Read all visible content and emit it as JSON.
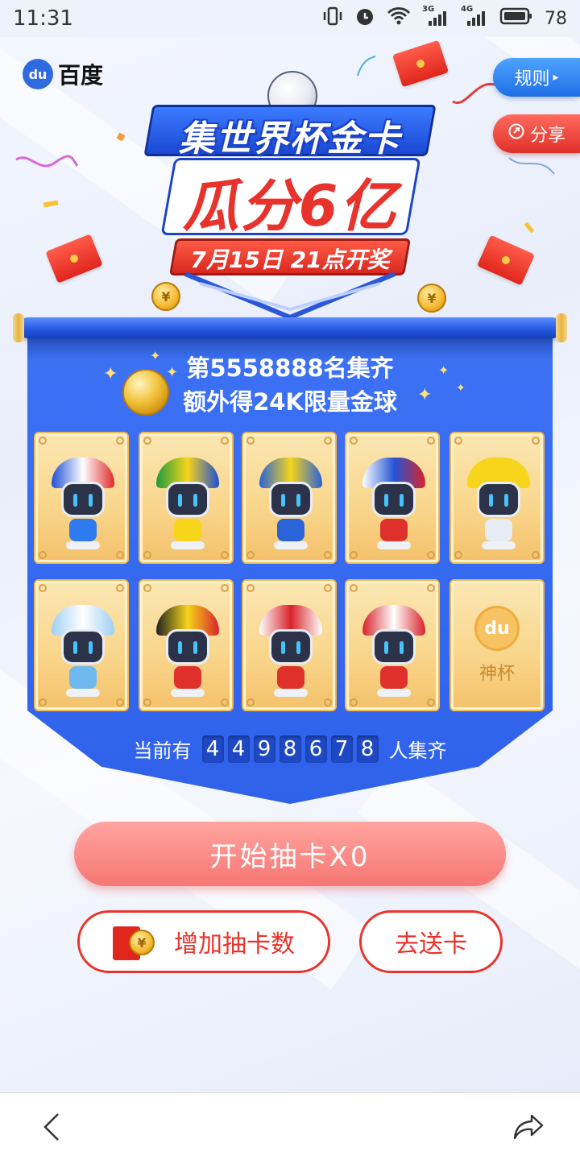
{
  "status_bar": {
    "time": "11:31",
    "net1": "3G",
    "net2": "4G",
    "battery": "78"
  },
  "app": {
    "brand": "百度",
    "logo_mark": "du"
  },
  "buttons": {
    "rules": "规则",
    "share": "分享",
    "draw": "开始抽卡X0",
    "add_draws": "增加抽卡数",
    "send_card": "去送卡"
  },
  "banner": {
    "line1": "集世界杯金卡",
    "line2": "瓜分6亿",
    "line3": "7月15日 21点开奖",
    "coin_symbol": "¥"
  },
  "panel": {
    "headline1": "第5558888名集齐",
    "headline2": "额外得24K限量金球"
  },
  "cards": [
    {
      "country": "france",
      "hat_colors": [
        "#1f4fd6",
        "#ffffff",
        "#e12b2b"
      ],
      "shirt": "#2e7bf0"
    },
    {
      "country": "brazil",
      "hat_colors": [
        "#1e9b3a",
        "#f6d51a",
        "#1f4fd6"
      ],
      "shirt": "#f6d51a"
    },
    {
      "country": "sweden",
      "hat_colors": [
        "#2a63d8",
        "#f6d51a",
        "#2a63d8"
      ],
      "shirt": "#2a63d8"
    },
    {
      "country": "russia",
      "hat_colors": [
        "#ffffff",
        "#2355d6",
        "#d8232a"
      ],
      "shirt": "#e0302b"
    },
    {
      "country": "golden-boot",
      "hat_colors": [
        "#f6d51a",
        "#f6d51a",
        "#f6d51a"
      ],
      "shirt": "#e6ebf4"
    },
    {
      "country": "argentina",
      "hat_colors": [
        "#9fd0f7",
        "#ffffff",
        "#9fd0f7"
      ],
      "shirt": "#6fb9f0"
    },
    {
      "country": "belgium",
      "hat_colors": [
        "#222222",
        "#f6d51a",
        "#d8232a"
      ],
      "shirt": "#e0302b"
    },
    {
      "country": "england",
      "hat_colors": [
        "#ffffff",
        "#d8232a",
        "#ffffff"
      ],
      "shirt": "#e0302b"
    },
    {
      "country": "croatia",
      "hat_colors": [
        "#d8232a",
        "#ffffff",
        "#d8232a"
      ],
      "shirt": "#e0302b"
    }
  ],
  "god_card": {
    "label": "神杯",
    "mark": "du"
  },
  "counter": {
    "prefix": "当前有",
    "digits": [
      "4",
      "4",
      "9",
      "8",
      "6",
      "7",
      "8"
    ],
    "suffix": "人集齐"
  },
  "colors": {
    "brand_blue": "#2f61ea",
    "accent_red": "#e9342b",
    "gold": "#f3c16a"
  },
  "icons": {
    "back": "chevron-left-icon",
    "forward": "share-arrow-icon"
  }
}
